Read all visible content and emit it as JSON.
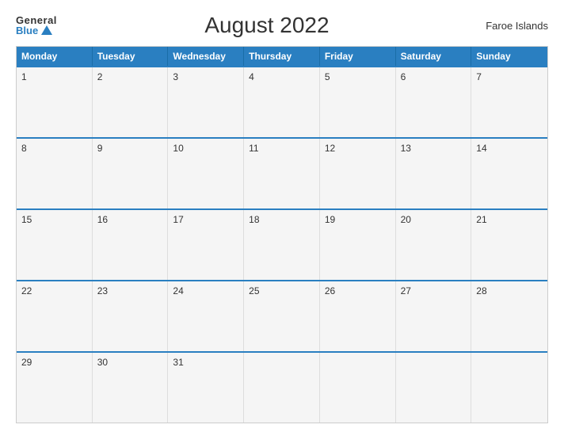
{
  "header": {
    "logo_general": "General",
    "logo_blue": "Blue",
    "title": "August 2022",
    "region": "Faroe Islands"
  },
  "calendar": {
    "headers": [
      "Monday",
      "Tuesday",
      "Wednesday",
      "Thursday",
      "Friday",
      "Saturday",
      "Sunday"
    ],
    "weeks": [
      [
        {
          "day": "1"
        },
        {
          "day": "2"
        },
        {
          "day": "3"
        },
        {
          "day": "4"
        },
        {
          "day": "5"
        },
        {
          "day": "6"
        },
        {
          "day": "7"
        }
      ],
      [
        {
          "day": "8"
        },
        {
          "day": "9"
        },
        {
          "day": "10"
        },
        {
          "day": "11"
        },
        {
          "day": "12"
        },
        {
          "day": "13"
        },
        {
          "day": "14"
        }
      ],
      [
        {
          "day": "15"
        },
        {
          "day": "16"
        },
        {
          "day": "17"
        },
        {
          "day": "18"
        },
        {
          "day": "19"
        },
        {
          "day": "20"
        },
        {
          "day": "21"
        }
      ],
      [
        {
          "day": "22"
        },
        {
          "day": "23"
        },
        {
          "day": "24"
        },
        {
          "day": "25"
        },
        {
          "day": "26"
        },
        {
          "day": "27"
        },
        {
          "day": "28"
        }
      ],
      [
        {
          "day": "29"
        },
        {
          "day": "30"
        },
        {
          "day": "31"
        },
        {
          "day": ""
        },
        {
          "day": ""
        },
        {
          "day": ""
        },
        {
          "day": ""
        }
      ]
    ]
  },
  "colors": {
    "header_bg": "#2a7fc1",
    "accent": "#2a7fc1"
  }
}
